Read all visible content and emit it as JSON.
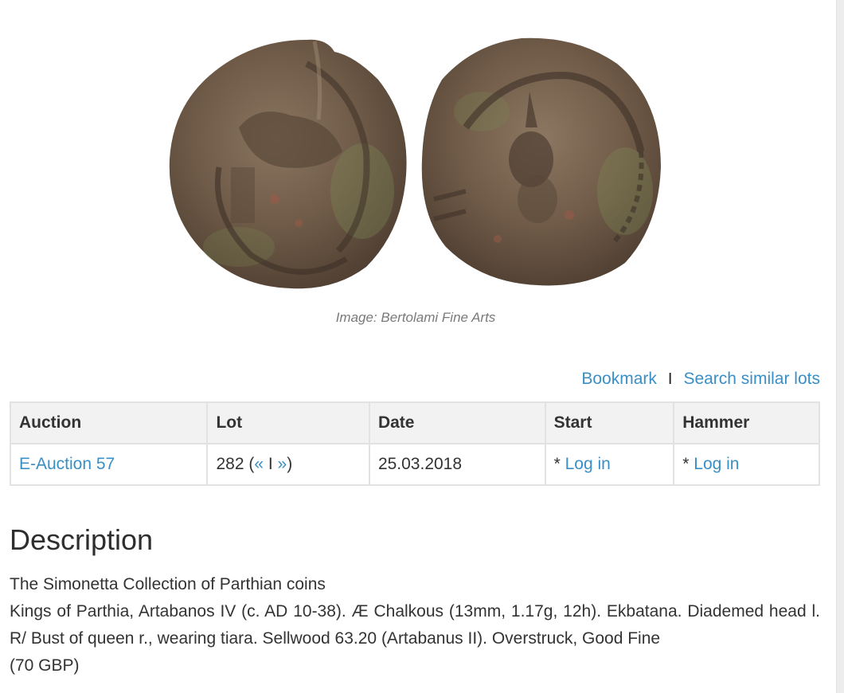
{
  "image": {
    "caption": "Image: Bertolami Fine Arts",
    "obverse_icon": "coin-obverse-diademed-head",
    "reverse_icon": "coin-reverse-bust-of-queen"
  },
  "actions": {
    "bookmark": "Bookmark",
    "separator": "I",
    "search_similar": "Search similar lots"
  },
  "lot_table": {
    "headers": [
      "Auction",
      "Lot",
      "Date",
      "Start",
      "Hammer"
    ],
    "row": {
      "auction": "E-Auction 57",
      "lot_number": "282 (",
      "prev": "«",
      "nav_sep": " I ",
      "next": "»",
      "lot_close": ")",
      "date": "25.03.2018",
      "start_prefix": "* ",
      "start_link": "Log in",
      "hammer_prefix": "* ",
      "hammer_link": "Log in"
    }
  },
  "description": {
    "title": "Description",
    "collection": "The Simonetta Collection of Parthian coins",
    "text": "Kings of Parthia, Artabanos IV (c. AD 10-38). Æ Chalkous (13mm, 1.17g, 12h). Ekbatana. Diademed head l. R/ Bust of queen r., wearing tiara. Sellwood 63.20 (Artabanus II). Overstruck, Good Fine",
    "estimate": "(70 GBP)"
  },
  "colors": {
    "link": "#3a8fc4",
    "table_header_bg": "#f2f2f2",
    "table_border": "#e2e2e2",
    "coin_base": "#6e5a47",
    "coin_patina": "#7d8a55"
  }
}
